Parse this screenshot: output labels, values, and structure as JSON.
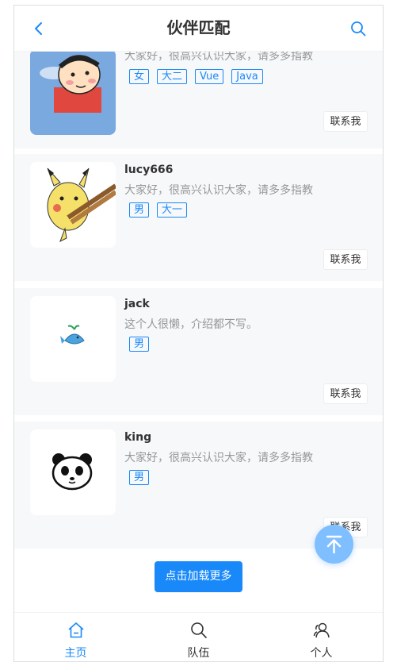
{
  "nav": {
    "title": "伙伴匹配"
  },
  "users": [
    {
      "name": "",
      "description": "大家好，很高兴认识大家，请多多指教",
      "tags": [
        "女",
        "大二",
        "Vue",
        "Java"
      ],
      "contact_label": "联系我",
      "avatar": "crayon-shin-chan-avatar"
    },
    {
      "name": "lucy666",
      "description": "大家好，很高兴认识大家，请多多指教",
      "tags": [
        "男",
        "大一"
      ],
      "contact_label": "联系我",
      "avatar": "pikachu-avatar"
    },
    {
      "name": "jack",
      "description": "这个人很懒，介绍都不写。",
      "tags": [
        "男"
      ],
      "contact_label": "联系我",
      "avatar": "whale-avatar"
    },
    {
      "name": "king",
      "description": "大家好，很高兴认识大家，请多多指教",
      "tags": [
        "男"
      ],
      "contact_label": "联系我",
      "avatar": "panda-avatar"
    }
  ],
  "load_more_label": "点击加载更多",
  "tabbar": [
    {
      "label": "主页",
      "icon": "home-icon",
      "active": true
    },
    {
      "label": "队伍",
      "icon": "search-icon",
      "active": false
    },
    {
      "label": "个人",
      "icon": "user-icon",
      "active": false
    }
  ],
  "colors": {
    "primary": "#1989fa",
    "card_bg": "#f7f8fa",
    "back_top": "#7fbfff"
  }
}
